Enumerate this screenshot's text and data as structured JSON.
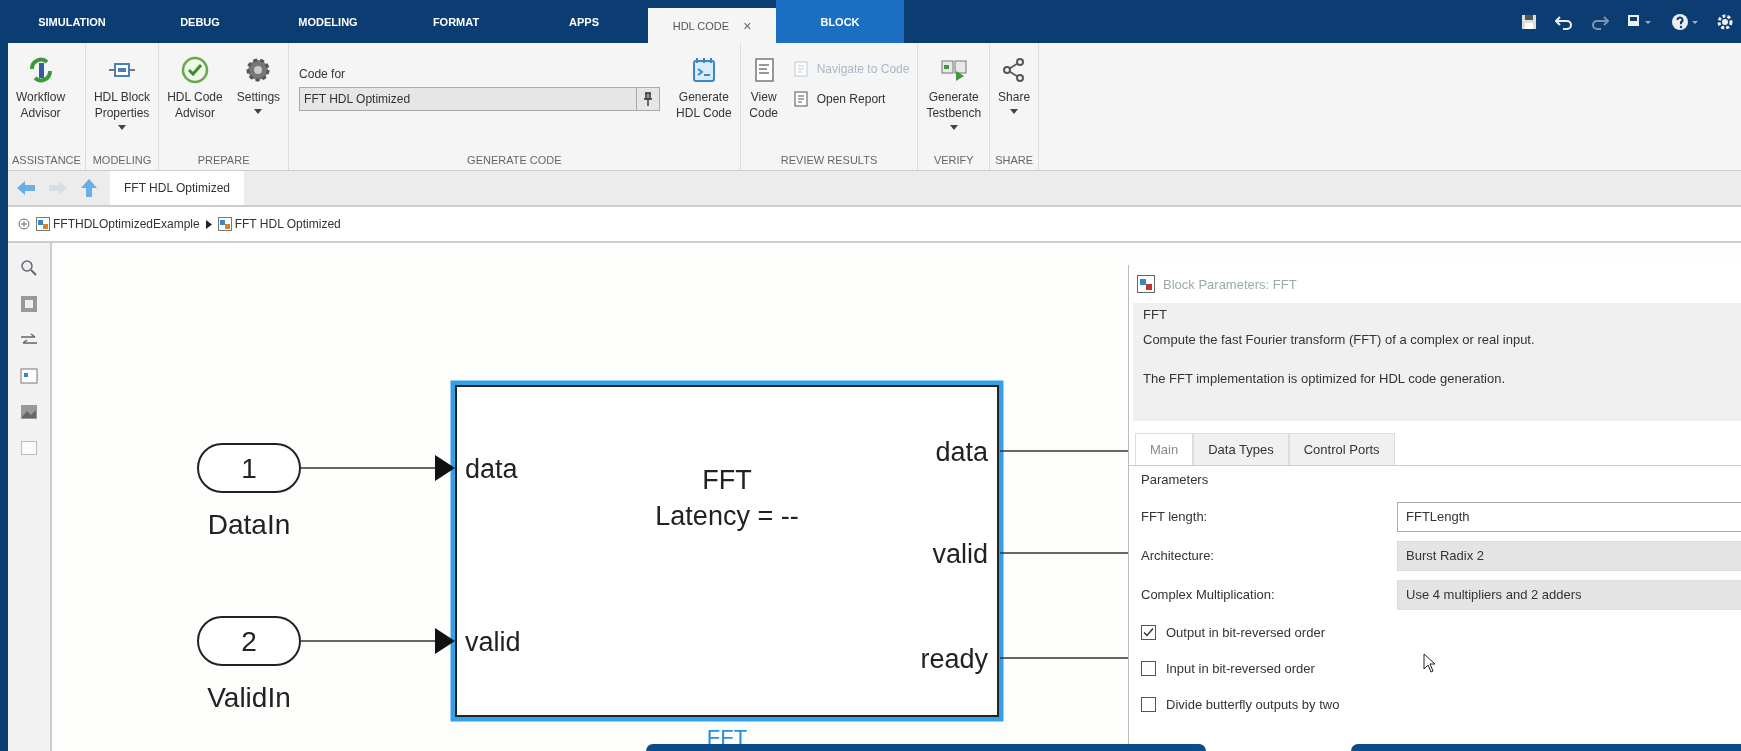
{
  "tabs": [
    {
      "label": "SIMULATION",
      "selected": false,
      "kind": "regular"
    },
    {
      "label": "DEBUG",
      "selected": false,
      "kind": "regular"
    },
    {
      "label": "MODELING",
      "selected": false,
      "kind": "regular"
    },
    {
      "label": "FORMAT",
      "selected": false,
      "kind": "regular"
    },
    {
      "label": "APPS",
      "selected": false,
      "kind": "regular"
    },
    {
      "label": "HDL CODE",
      "selected": true,
      "kind": "regular",
      "close": "×"
    },
    {
      "label": "BLOCK",
      "selected": false,
      "kind": "contextual"
    }
  ],
  "ribbon": [
    {
      "title": "ASSISTANCE",
      "items": [
        {
          "kind": "large",
          "label": "Workflow\nAdvisor",
          "dropdown": false
        }
      ]
    },
    {
      "title": "MODELING",
      "items": [
        {
          "kind": "large",
          "label": "HDL Block\nProperties",
          "dropdown": true
        }
      ]
    },
    {
      "title": "PREPARE",
      "items": [
        {
          "kind": "large",
          "label": "HDL Code\nAdvisor",
          "dropdown": false
        },
        {
          "kind": "large",
          "label": "Settings",
          "dropdown": true
        }
      ]
    },
    {
      "title": "GENERATE CODE",
      "items": [
        {
          "kind": "field",
          "label": "Code for",
          "value": "FFT HDL Optimized"
        },
        {
          "kind": "large",
          "label": "Generate\nHDL Code",
          "dropdown": false
        }
      ]
    },
    {
      "title": "REVIEW RESULTS",
      "items": [
        {
          "kind": "large",
          "label": "View\nCode",
          "dropdown": false
        },
        {
          "kind": "small",
          "label": "Navigate to Code",
          "disabled": true
        },
        {
          "kind": "small",
          "label": "Open Report",
          "disabled": false
        }
      ]
    },
    {
      "title": "VERIFY",
      "items": [
        {
          "kind": "large",
          "label": "Generate\nTestbench",
          "dropdown": true
        }
      ]
    },
    {
      "title": "SHARE",
      "items": [
        {
          "kind": "large",
          "label": "Share",
          "dropdown": true
        }
      ]
    }
  ],
  "nav_tab": "FFT HDL Optimized",
  "breadcrumb": [
    "FFTHDLOptimizedExample",
    "FFT HDL Optimized"
  ],
  "diagram": {
    "inports": [
      {
        "number": "1",
        "name": "DataIn",
        "port": "data"
      },
      {
        "number": "2",
        "name": "ValidIn",
        "port": "valid"
      }
    ],
    "block": {
      "name": "FFT",
      "title": "FFT",
      "subtitle": "Latency = --",
      "outputs": [
        "data",
        "valid",
        "ready"
      ],
      "selected": true
    }
  },
  "dialog": {
    "title": "Block Parameters: FFT",
    "section": "FFT",
    "description": [
      "Compute the fast Fourier transform (FFT) of a complex or real input.",
      "The FFT implementation is optimized for HDL code generation."
    ],
    "tabs": [
      {
        "label": "Main",
        "selected": true
      },
      {
        "label": "Data Types",
        "selected": false
      },
      {
        "label": "Control Ports",
        "selected": false
      }
    ],
    "group": "Parameters",
    "params": [
      {
        "label": "FFT length:",
        "value": "FFTLength",
        "kind": "edit"
      },
      {
        "label": "Architecture:",
        "value": "Burst Radix 2",
        "kind": "select"
      },
      {
        "label": "Complex Multiplication:",
        "value": "Use 4 multipliers and 2 adders",
        "kind": "select"
      }
    ],
    "checkboxes": [
      {
        "label": "Output in bit-reversed order",
        "checked": true
      },
      {
        "label": "Input in bit-reversed order",
        "checked": false
      },
      {
        "label": "Divide butterfly outputs by two",
        "checked": false
      }
    ]
  }
}
